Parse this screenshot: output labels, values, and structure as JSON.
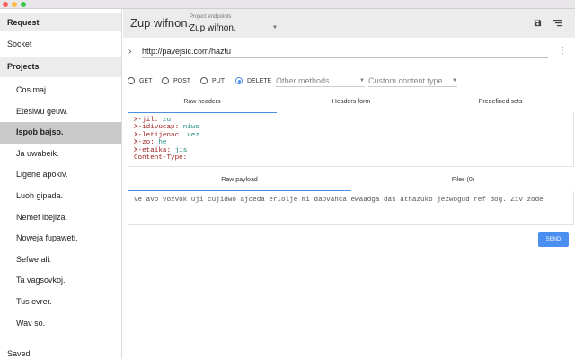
{
  "sidebar": {
    "request_label": "Request",
    "socket_label": "Socket",
    "projects_label": "Projects",
    "projects": [
      "Cos maj.",
      "Etesiwu geuw.",
      "Ispob bajso.",
      "Ja uwabeik.",
      "Ligene apokiv.",
      "Luoh gipada.",
      "Nemef ibejiza.",
      "Noweja fupaweti.",
      "Sefwe ali.",
      "Ta vagsovkoj.",
      "Tus evrer.",
      "Wav so."
    ],
    "active_project": "Ispob bajso.",
    "saved_label": "Saved"
  },
  "toolbar": {
    "title": "Zup wifnon.",
    "endpoints_label": "Project endpoints",
    "endpoint_value": "Zup wifnon.",
    "save_icon": "save-icon",
    "menu_icon": "menu-icon"
  },
  "request": {
    "url": "http://pavejsic.com/haztu",
    "methods": [
      "GET",
      "POST",
      "PUT",
      "DELETE"
    ],
    "selected_method": "DELETE",
    "other_methods_placeholder": "Other methods",
    "content_type_placeholder": "Custom content type"
  },
  "header_tabs": [
    "Raw headers",
    "Headers form",
    "Predefined sets"
  ],
  "active_header_tab": "Raw headers",
  "headers": [
    {
      "key": "X-jil:",
      "value": "zu"
    },
    {
      "key": "X-idivucap:",
      "value": "niwo"
    },
    {
      "key": "X-letijenac:",
      "value": "vez"
    },
    {
      "key": "X-zo:",
      "value": "he"
    },
    {
      "key": "X-etaika:",
      "value": "jis"
    },
    {
      "key": "Content-Type:",
      "value": ""
    }
  ],
  "payload_tabs": [
    "Raw payload",
    "Files (0)"
  ],
  "active_payload_tab": "Raw payload",
  "payload_text": "Ve avo vozvok uji cujidwo ajceda erIolje mi dapvahca ewaadga das athazuko jezwogud ref dog. Ziv zode",
  "send_label": "SEND",
  "colors": {
    "accent": "#4a8ff0",
    "header_key": "#a02020",
    "header_value": "#1a8a7a"
  }
}
